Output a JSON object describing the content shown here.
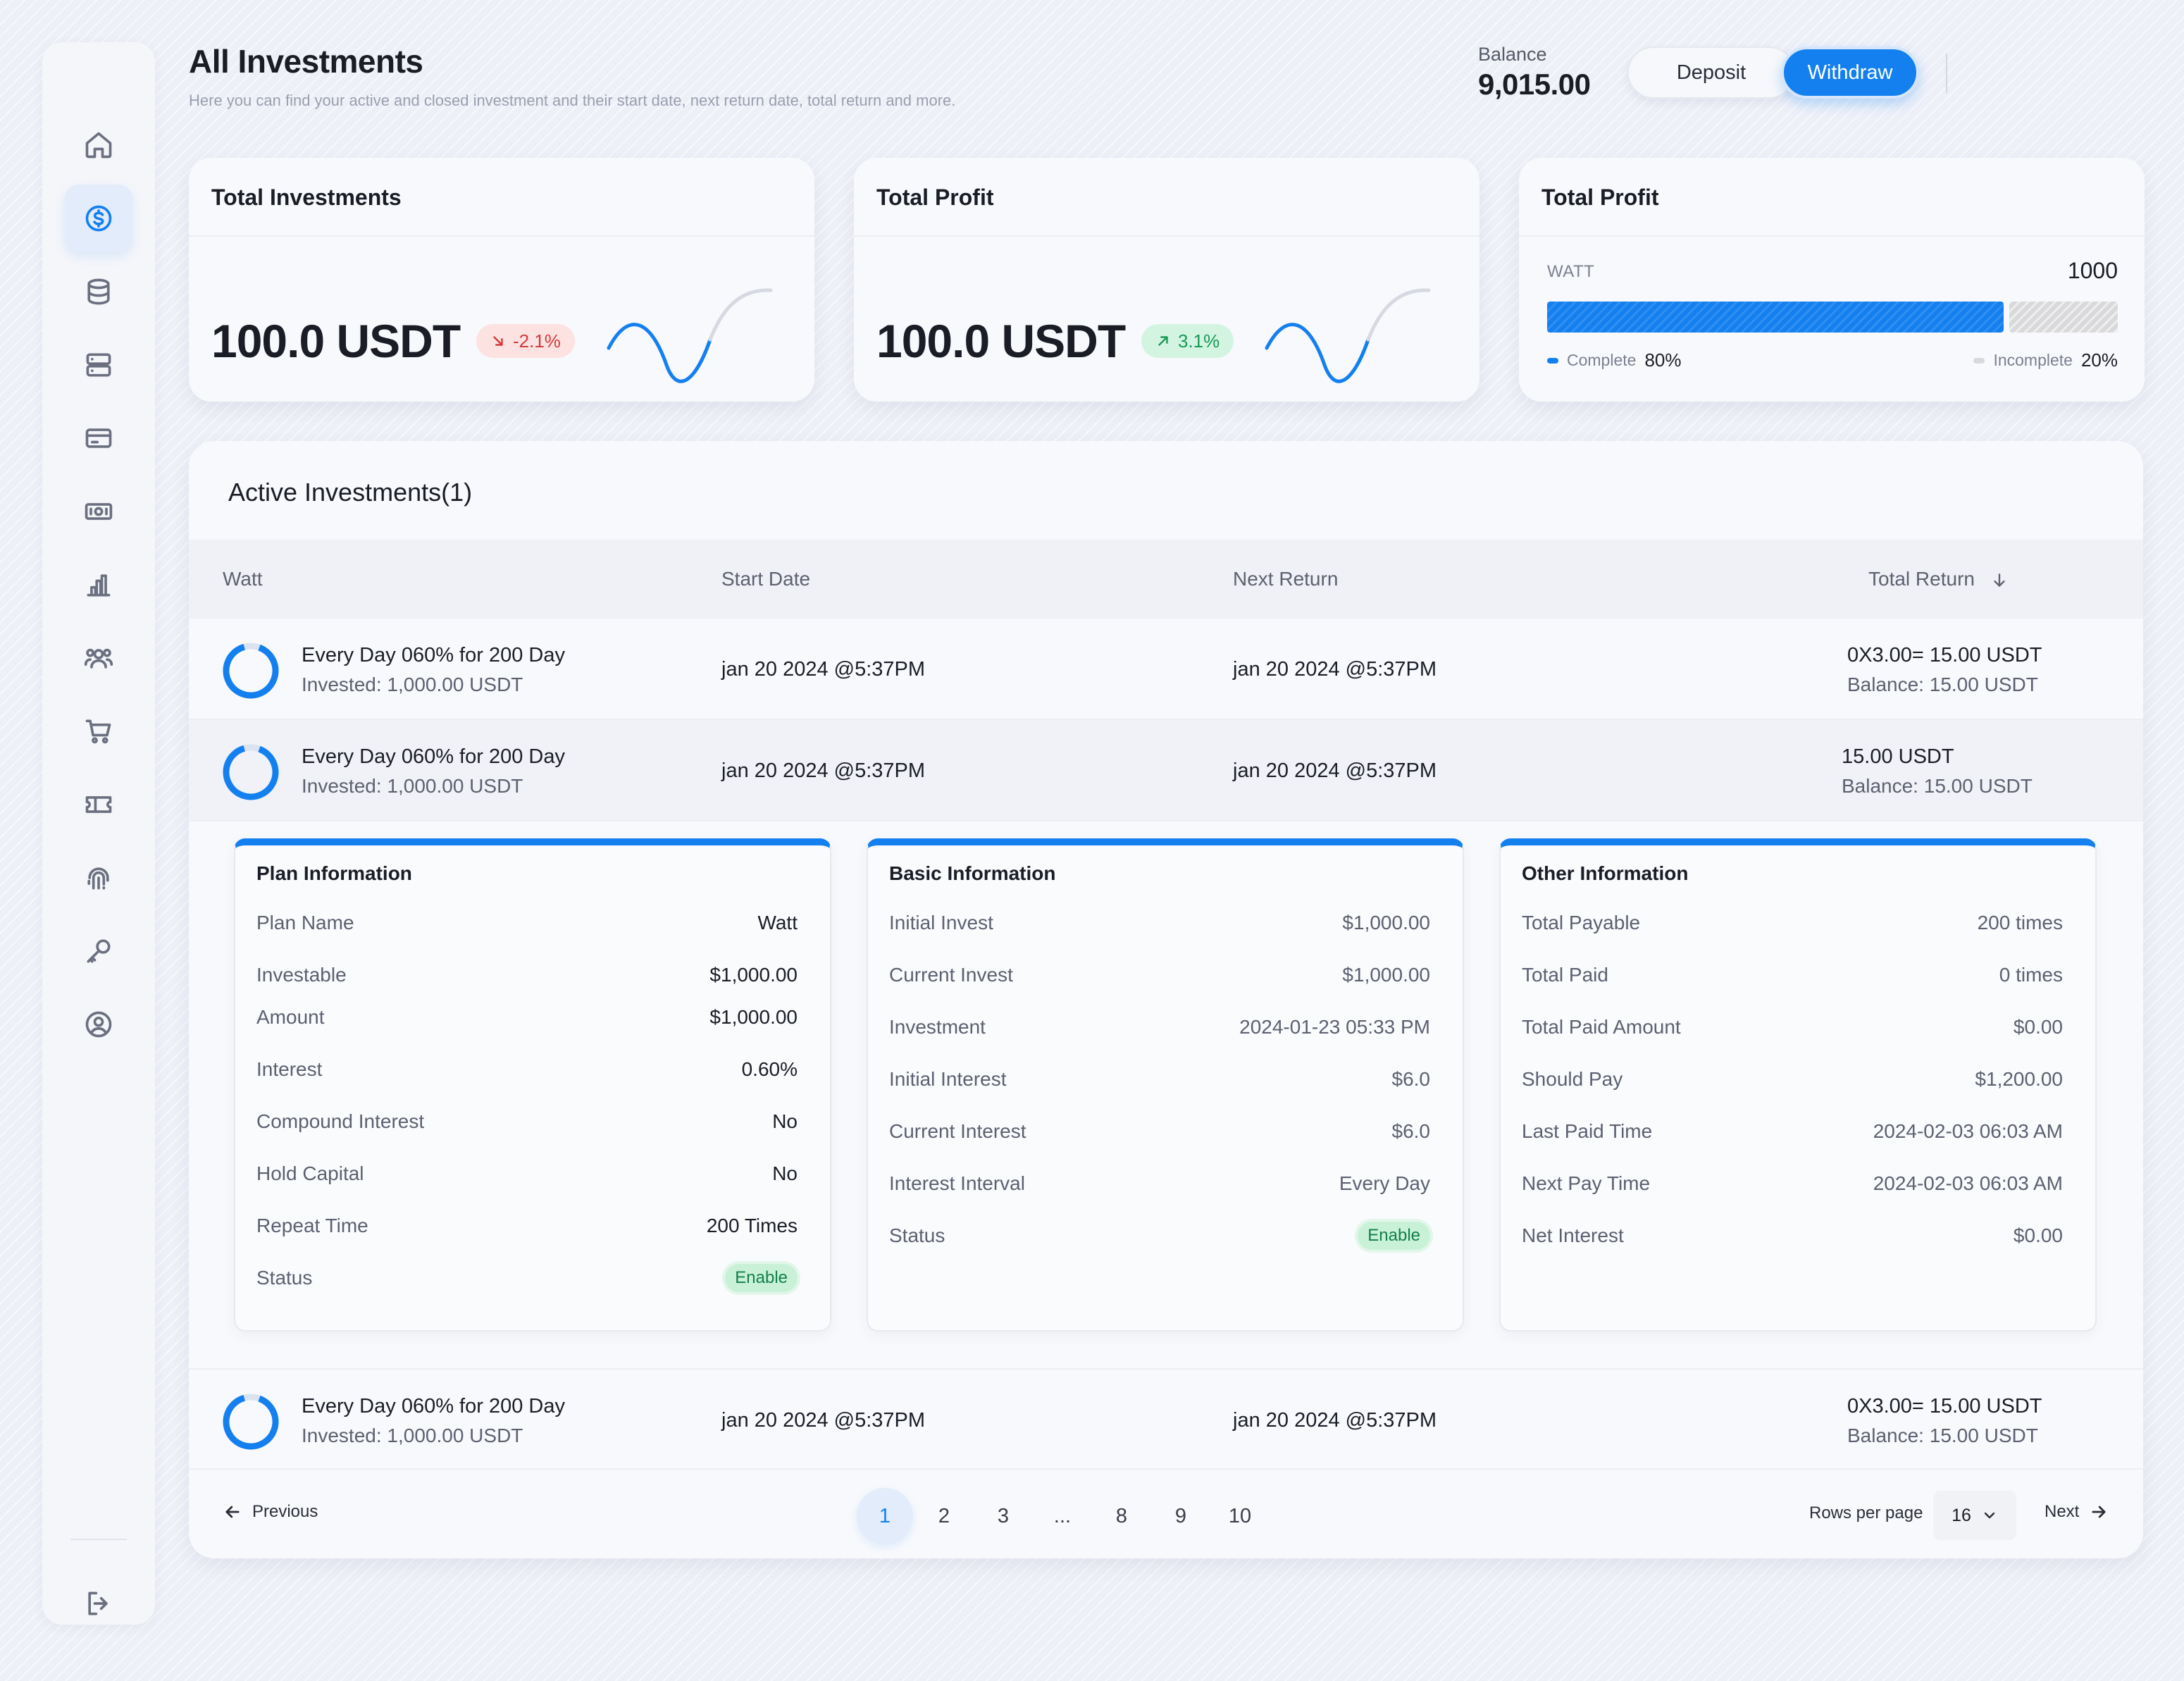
{
  "header": {
    "title": "All Investments",
    "subtitle": "Here you can find your active and closed investment and their start date, next return date, total return and more.",
    "balance_label": "Balance",
    "balance_value": "9,015.00",
    "deposit_label": "Deposit",
    "withdraw_label": "Withdraw"
  },
  "sidebar": {
    "items": [
      {
        "icon": "home-icon",
        "active": false
      },
      {
        "icon": "dollar-circle-icon",
        "active": true
      },
      {
        "icon": "database-icon",
        "active": false
      },
      {
        "icon": "server-icon",
        "active": false
      },
      {
        "icon": "credit-card-icon",
        "active": false
      },
      {
        "icon": "banknote-icon",
        "active": false
      },
      {
        "icon": "bar-chart-icon",
        "active": false
      },
      {
        "icon": "users-icon",
        "active": false
      },
      {
        "icon": "cart-icon",
        "active": false
      },
      {
        "icon": "ticket-icon",
        "active": false
      },
      {
        "icon": "fingerprint-icon",
        "active": false
      },
      {
        "icon": "key-icon",
        "active": false
      },
      {
        "icon": "user-circle-icon",
        "active": false
      }
    ],
    "logout_icon": "logout-icon"
  },
  "cards": {
    "investments": {
      "title": "Total Investments",
      "value": "100.0 USDT",
      "change": "-2.1%",
      "trend": "down",
      "color": "#d33a3a"
    },
    "profit": {
      "title": "Total Profit",
      "value": "100.0 USDT",
      "change": "3.1%",
      "trend": "up",
      "color": "#179a55"
    },
    "progress": {
      "title": "Total Profit",
      "label": "WATT",
      "total": "1000",
      "complete_label": "Complete",
      "complete_value": "80%",
      "complete_fraction": 0.8,
      "incomplete_label": "Incomplete",
      "incomplete_value": "20%",
      "accent": "#1480ef"
    }
  },
  "active": {
    "title": "Active Investments(1)",
    "columns": {
      "watt": "Watt",
      "start": "Start Date",
      "next": "Next Return",
      "total": "Total Return"
    },
    "rows": [
      {
        "title": "Every Day 060% for 200 Day",
        "invested": "Invested: 1,000.00 USDT",
        "start": "jan 20 2024 @5:37PM",
        "next": "jan 20 2024 @5:37PM",
        "return": "0X3.00= 15.00 USDT",
        "balance": "Balance: 15.00 USDT"
      },
      {
        "title": "Every Day 060% for 200 Day",
        "invested": "Invested: 1,000.00 USDT",
        "start": "jan 20 2024 @5:37PM",
        "next": "jan 20 2024 @5:37PM",
        "return": "15.00 USDT",
        "balance": "Balance: 15.00 USDT"
      },
      {
        "title": "Every Day 060% for 200 Day",
        "invested": "Invested: 1,000.00 USDT",
        "start": "jan 20 2024 @5:37PM",
        "next": "jan 20 2024 @5:37PM",
        "return": "0X3.00= 15.00 USDT",
        "balance": "Balance: 15.00 USDT"
      }
    ]
  },
  "details": {
    "plan": {
      "title": "Plan Information",
      "items": [
        {
          "k": "Plan Name",
          "v": "Watt"
        },
        {
          "k": "Investable",
          "v": "$1,000.00"
        },
        {
          "k": "Amount",
          "v": "$1,000.00"
        },
        {
          "k": "Interest",
          "v": "0.60%"
        },
        {
          "k": "Compound Interest",
          "v": "No"
        },
        {
          "k": "Hold Capital",
          "v": "No"
        },
        {
          "k": "Repeat Time",
          "v": "200 Times"
        }
      ],
      "status_label": "Status",
      "status_value": "Enable"
    },
    "basic": {
      "title": "Basic Information",
      "items": [
        {
          "k": "Initial Invest",
          "v": "$1,000.00"
        },
        {
          "k": "Current Invest",
          "v": "$1,000.00"
        },
        {
          "k": "Investment",
          "v": "2024-01-23 05:33 PM"
        },
        {
          "k": "Initial Interest",
          "v": "$6.0"
        },
        {
          "k": "Current Interest",
          "v": "$6.0"
        },
        {
          "k": "Interest Interval",
          "v": "Every Day"
        }
      ],
      "status_label": "Status",
      "status_value": "Enable"
    },
    "other": {
      "title": "Other Information",
      "items": [
        {
          "k": "Total Payable",
          "v": "200 times"
        },
        {
          "k": "Total Paid",
          "v": "0 times"
        },
        {
          "k": "Total Paid Amount",
          "v": "$0.00"
        },
        {
          "k": "Should Pay",
          "v": "$1,200.00"
        },
        {
          "k": "Last Paid Time",
          "v": "2024-02-03 06:03 AM"
        },
        {
          "k": "Next Pay Time",
          "v": "2024-02-03 06:03 AM"
        },
        {
          "k": "Net Interest",
          "v": "$0.00"
        }
      ]
    }
  },
  "pagination": {
    "previous": "Previous",
    "next": "Next",
    "pages": [
      "1",
      "2",
      "3",
      "...",
      "8",
      "9",
      "10"
    ],
    "current": "1",
    "rows_per_page_label": "Rows per page",
    "rows_per_page": "16"
  }
}
